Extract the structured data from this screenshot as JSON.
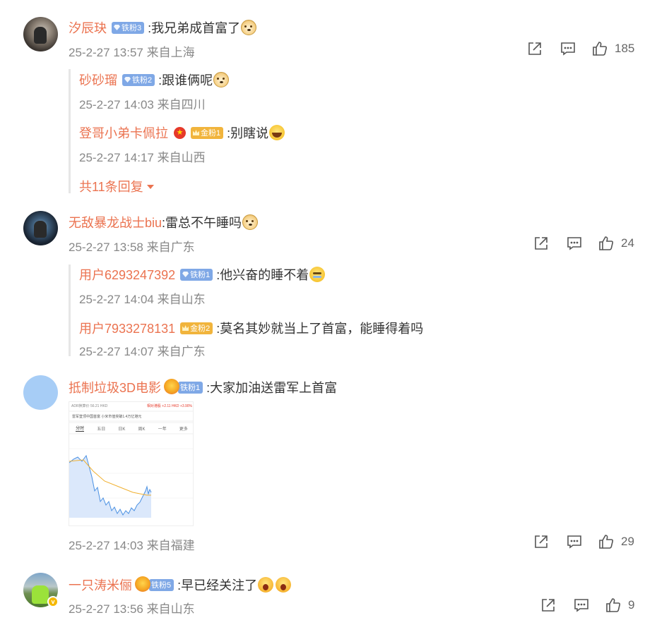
{
  "comments": [
    {
      "user": "汐辰玦",
      "badge": "铁粉3",
      "text": ":我兄弟成首富了",
      "meta": "25-2-27 13:57 来自上海",
      "likes": "185",
      "replies": [
        {
          "user": "砂砂瑠",
          "badge": "铁粉2",
          "text": ":跟谁俩呢",
          "meta": "25-2-27 14:03 来自四川"
        },
        {
          "user": "登哥小弟卡佩拉",
          "badge": "金粉1",
          "text": ":别瞎说",
          "meta": "25-2-27 14:17 来自山西"
        }
      ],
      "more_replies": "共11条回复"
    },
    {
      "user": "无敌暴龙战士biu",
      "text": ":雷总不午睡吗",
      "meta": "25-2-27 13:58 来自广东",
      "likes": "24",
      "replies": [
        {
          "user": "用户6293247392",
          "badge": "铁粉1",
          "text": ":他兴奋的睡不着",
          "meta": "25-2-27 14:04 来自山东"
        },
        {
          "user": "用户7933278131",
          "badge": "金粉2",
          "text": ":莫名其妙就当上了首富，能睡得着吗",
          "meta": "25-2-27 14:07 来自广东"
        }
      ]
    },
    {
      "user": "抵制垃圾3D电影",
      "badge": "铁粉1",
      "text": ":大家加油送雷军上首富",
      "meta": "25-2-27 14:03 来自福建",
      "likes": "29",
      "image": {
        "hdr_left": "ADR换算价 56.21 HKD",
        "hdr_right": "相对港股 +2.11 HKD +3.90%",
        "sub": "雷军登顶中国首富 小米市值突破1.4万亿港元",
        "tabs": [
          "分时",
          "五日",
          "日K",
          "周K",
          "一年",
          "更多"
        ]
      }
    },
    {
      "user": "一只涛米俪",
      "badge": "铁粉5",
      "text": ":早已经关注了",
      "meta": "25-2-27 13:56 来自山东",
      "likes": "9"
    }
  ],
  "colors": {
    "username": "#eb7350",
    "meta": "#888888",
    "iron_badge": "#7fa8e6",
    "gold_badge": "#f1b43c"
  },
  "icons": [
    "share-icon",
    "comment-icon",
    "like-icon"
  ]
}
